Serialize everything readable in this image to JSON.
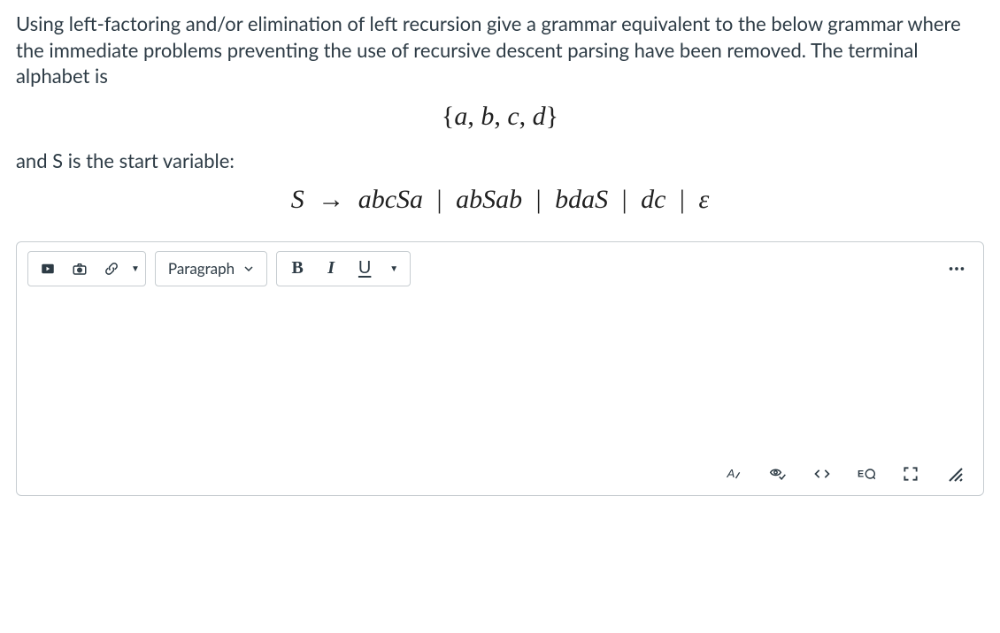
{
  "question": {
    "intro": "Using left-factoring and/or elimination of left recursion give a grammar equivalent to the below grammar where the immediate problems preventing the use of recursive descent parsing have been removed. The terminal alphabet is",
    "alphabet": "{a, b, c, d}",
    "intro2": "and S is the start variable:",
    "grammar_lhs": "S",
    "grammar_rhs_1": "abcSa",
    "grammar_rhs_2": "abSab",
    "grammar_rhs_3": "bdaS",
    "grammar_rhs_4": "dc",
    "grammar_rhs_5": "ε"
  },
  "toolbar": {
    "media_icon": "media",
    "camera_icon": "camera",
    "link_icon": "link",
    "paragraph_label": "Paragraph",
    "bold": "B",
    "italic": "I",
    "underline": "U",
    "more": "⋯"
  },
  "statusbar": {
    "a11y": "A",
    "checkmark": "✓",
    "html": "</>",
    "eq": "EQ",
    "fullscreen": "⛶"
  }
}
